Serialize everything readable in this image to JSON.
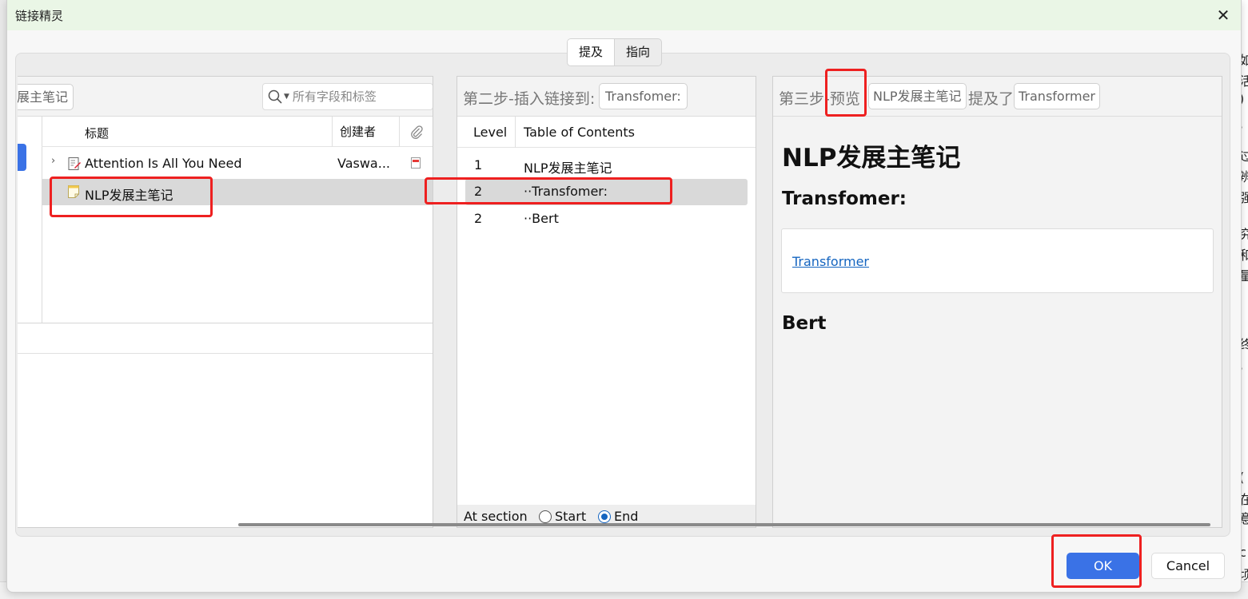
{
  "dialog": {
    "title": "链接精灵",
    "close_glyph": "✕"
  },
  "tabs": [
    {
      "label": "提及",
      "active": true
    },
    {
      "label": "指向",
      "active": false
    }
  ],
  "left_pane": {
    "breadcrumb": "展主笔记",
    "search_placeholder": "所有字段和标签",
    "columns": {
      "title": "标题",
      "creator": "创建者",
      "attachment_icon": "paperclip-icon"
    },
    "rows": [
      {
        "title": "Attention Is All You Need",
        "creator": "Vaswa...",
        "icon": "document-edit-icon",
        "attachment": "pdf-icon"
      },
      {
        "title": "NLP发展主笔记",
        "creator": "",
        "icon": "note-icon",
        "selected": true
      }
    ]
  },
  "middle_pane": {
    "step_label": "第二步-插入链接到:",
    "target": "Transfomer:",
    "columns": {
      "level": "Level",
      "toc": "Table of Contents"
    },
    "rows": [
      {
        "level": "1",
        "name": "NLP发展主笔记"
      },
      {
        "level": "2",
        "name": "··Transfomer:",
        "selected": true
      },
      {
        "level": "2",
        "name": "··Bert"
      }
    ],
    "at_section_label": "At section",
    "options": [
      {
        "label": "Start",
        "checked": false
      },
      {
        "label": "End",
        "checked": true
      }
    ]
  },
  "right_pane": {
    "step_label": "第三步-预览",
    "note_pill": "NLP发展主笔记",
    "mentioned_label": "提及了",
    "item_pill": "Transformer",
    "preview": {
      "h1": "NLP发展主笔记",
      "h2": "Transfomer:",
      "link": "Transformer",
      "h3": "Bert"
    }
  },
  "buttons": {
    "ok": "OK",
    "cancel": "Cancel"
  },
  "colors": {
    "accent": "#3a72e6",
    "titlebar": "#eaf6e6",
    "annotation_red": "#ee2020",
    "link": "#1565c0"
  },
  "background_glyphs": [
    "如",
    "活",
    ")",
    "·",
    "过",
    "辨",
    "强",
    "究",
    "和",
    "量",
    "终",
    "·",
    "(",
    "在",
    "意",
    "c",
    "顷"
  ]
}
